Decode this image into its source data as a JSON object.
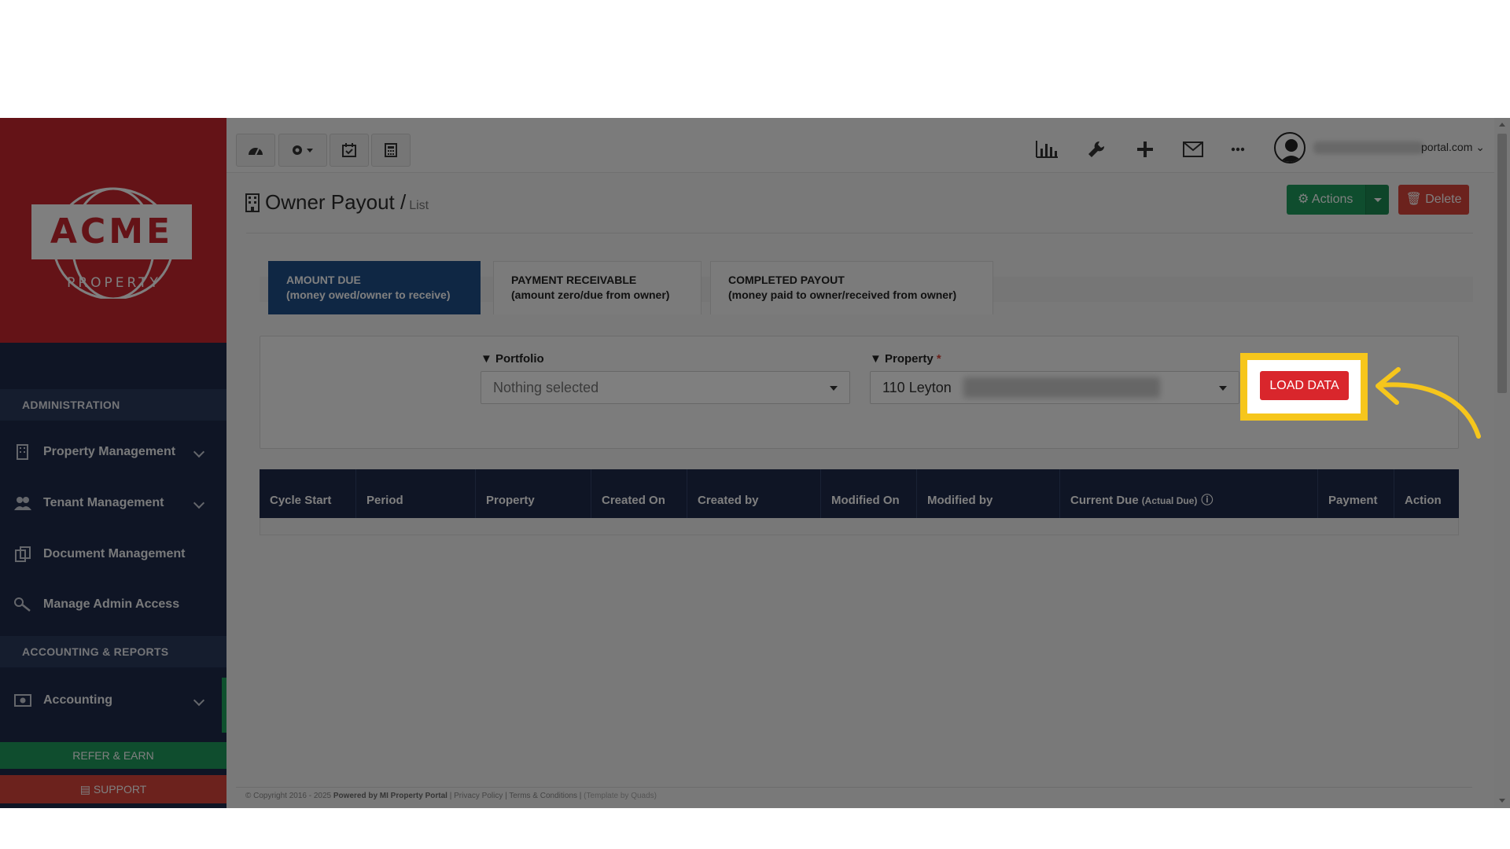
{
  "sidebar": {
    "logo_word": "ACME",
    "logo_sub": "PROPERTY",
    "section_admin": "ADMINISTRATION",
    "section_accounting": "ACCOUNTING & REPORTS",
    "items": [
      {
        "label": "Property Management"
      },
      {
        "label": "Tenant Management"
      },
      {
        "label": "Document Management"
      },
      {
        "label": "Manage Admin Access"
      },
      {
        "label": "Accounting"
      }
    ],
    "refer_label": "REFER & EARN",
    "support_label": "SUPPORT"
  },
  "topbar": {
    "user_suffix": "portal.com"
  },
  "header": {
    "title": "Owner Payout /",
    "subtitle": "List",
    "actions_label": "Actions",
    "delete_label": "Delete"
  },
  "tabs": [
    {
      "line1": "AMOUNT DUE",
      "line2": "(money owed/owner to receive)"
    },
    {
      "line1": "PAYMENT RECEIVABLE",
      "line2": "(amount zero/due from owner)"
    },
    {
      "line1": "COMPLETED PAYOUT",
      "line2": "(money paid to owner/received from owner)"
    }
  ],
  "filters": {
    "portfolio_label": "Portfolio",
    "portfolio_value": "Nothing selected",
    "property_label": "Property",
    "property_required": "*",
    "property_value": "110 Leyton",
    "load_label": "LOAD DATA"
  },
  "table": {
    "columns": [
      "Cycle Start",
      "Period",
      "Property",
      "Created On",
      "Created by",
      "Modified On",
      "Modified by",
      "Current Due",
      "Payment",
      "Action"
    ],
    "current_due_sub": "(Actual Due)"
  },
  "footer": {
    "copyright": "© Copyright 2016 - 2025",
    "powered": "Powered by MI Property Portal",
    "links": "| Privacy Policy | Terms & Conditions |",
    "template": "(Template by Quads)"
  },
  "colors": {
    "sidebar_bg": "#1e2a4a",
    "logo_bg": "#c8262f",
    "primary_tab": "#1f4f89",
    "success": "#1f9a5c",
    "danger": "#d9453a",
    "highlight": "#f6c61c"
  }
}
